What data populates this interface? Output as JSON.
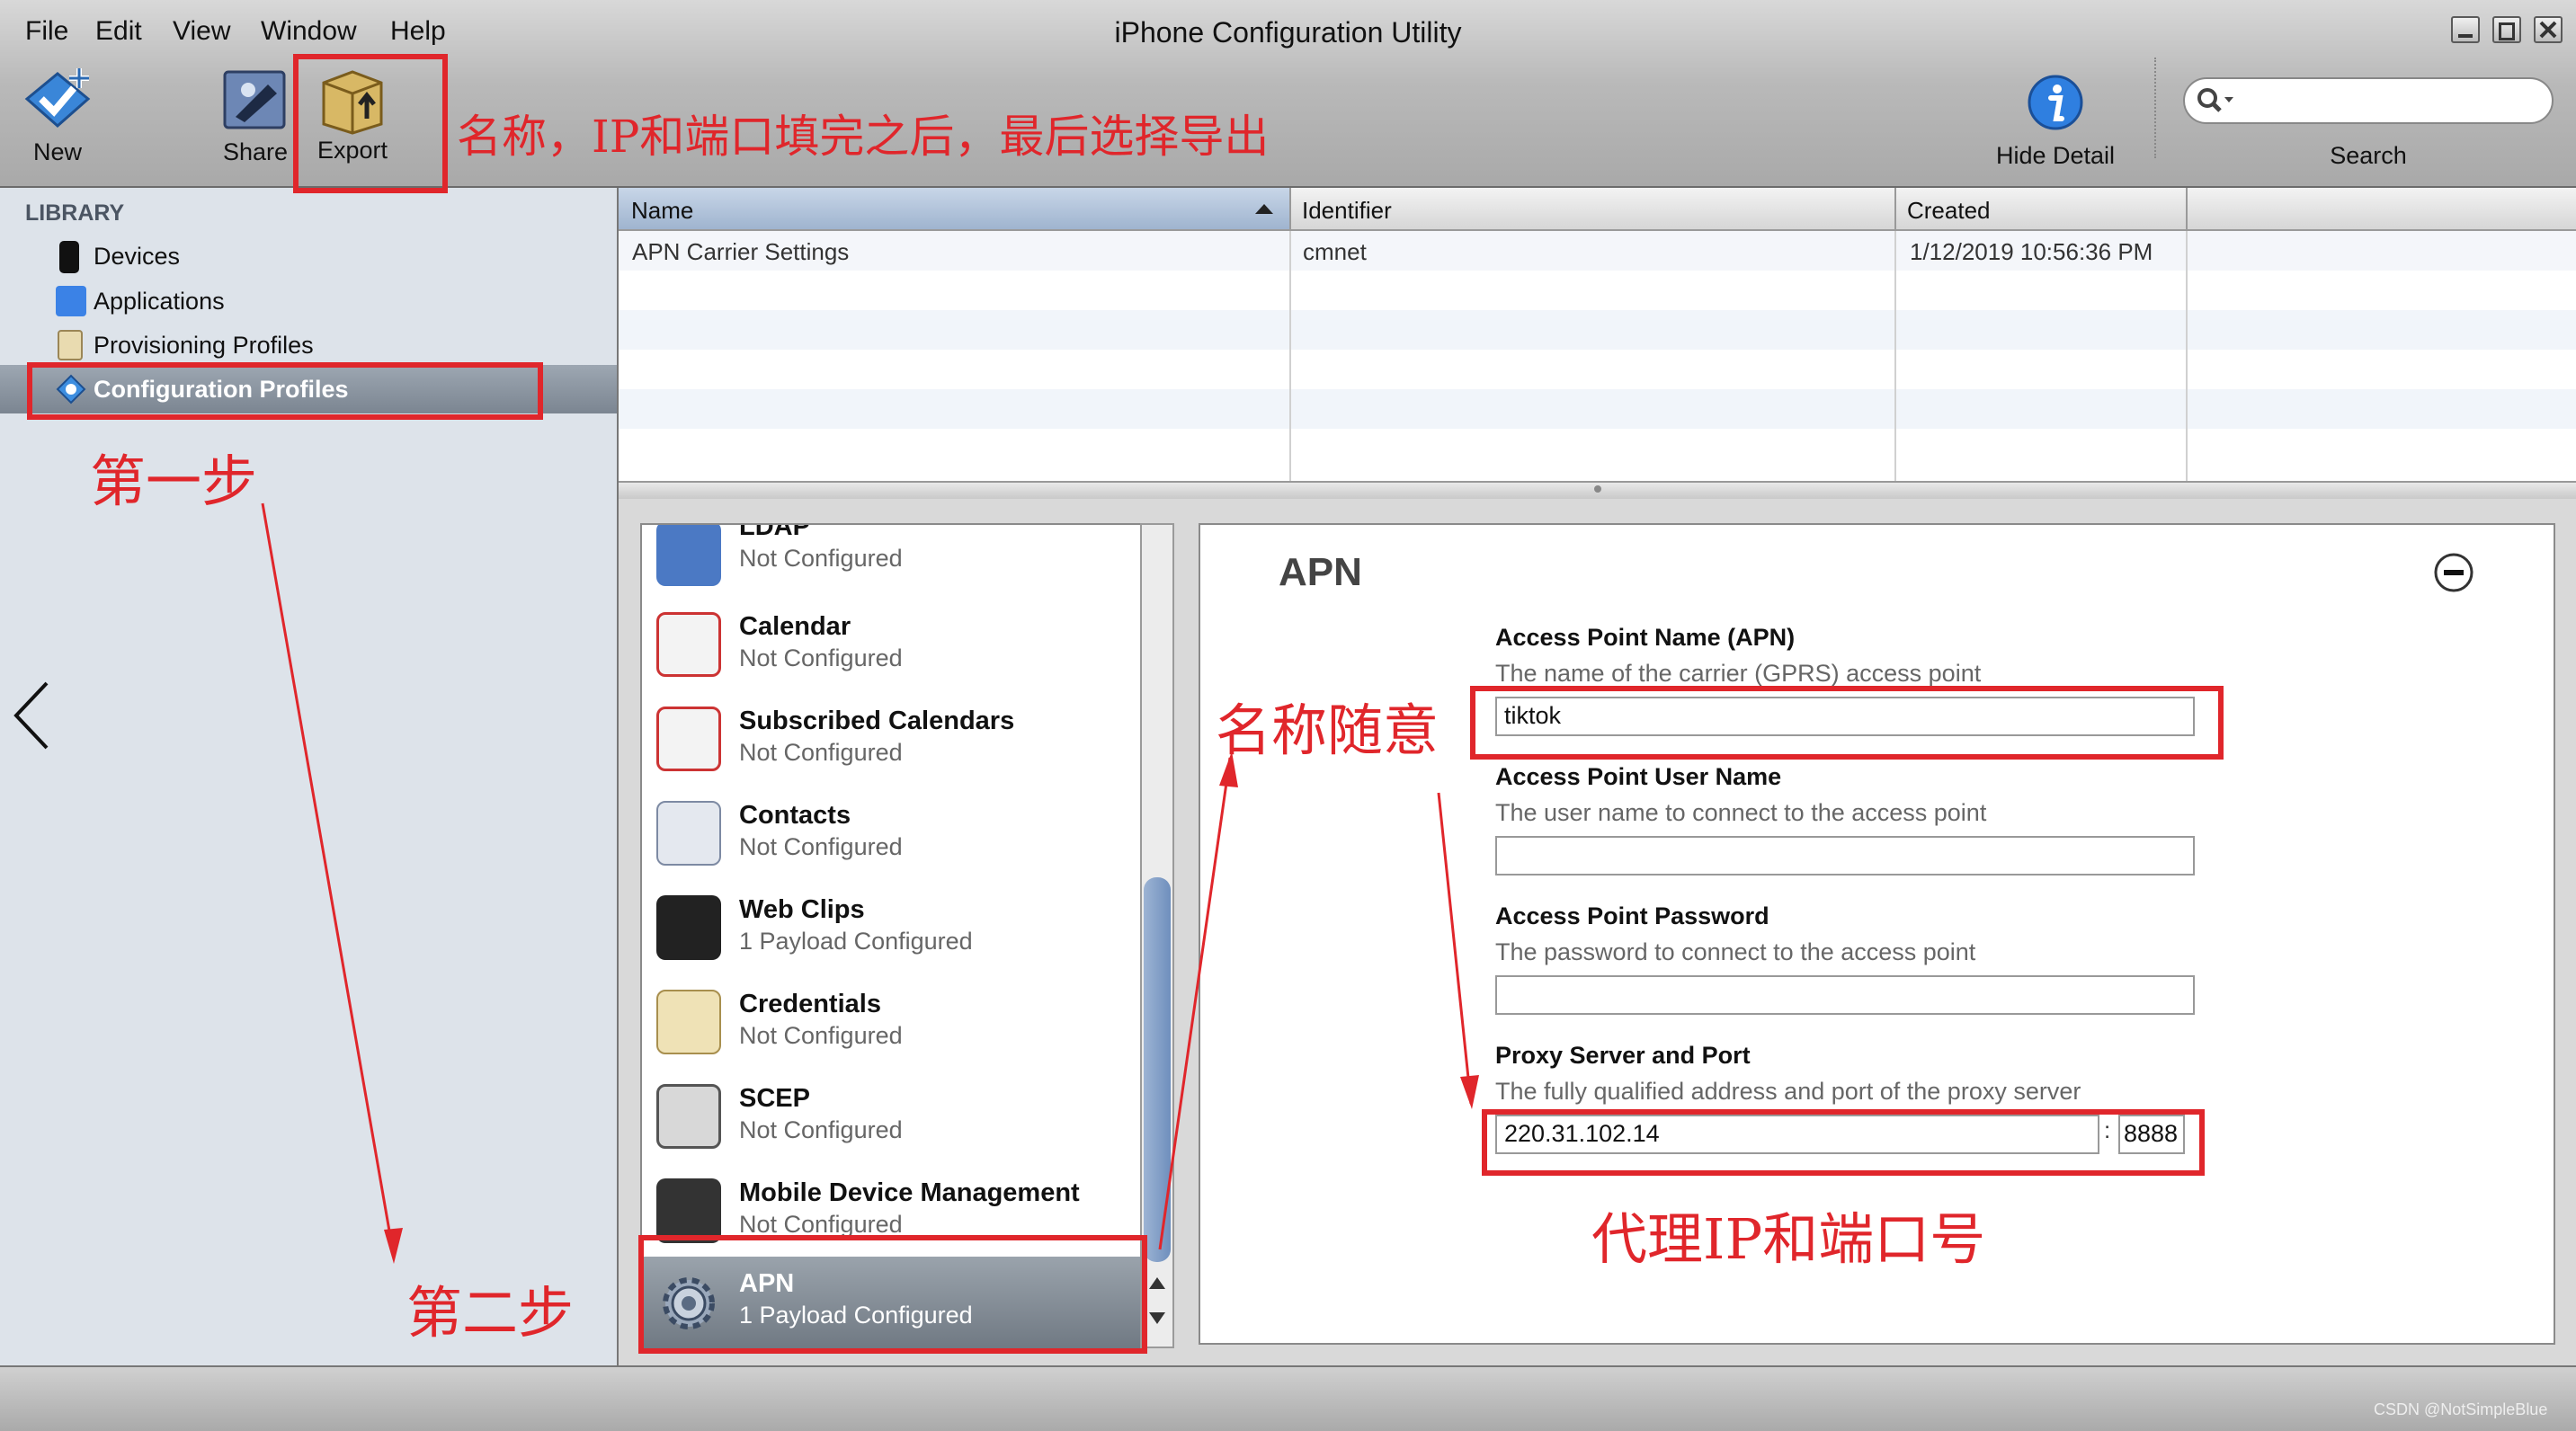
{
  "menu": [
    "File",
    "Edit",
    "View",
    "Window",
    "Help"
  ],
  "window_title": "iPhone Configuration Utility",
  "toolbar": {
    "new_label": "New",
    "share_label": "Share",
    "export_label": "Export",
    "hide_detail_label": "Hide Detail",
    "search_label": "Search",
    "search_value": ""
  },
  "sidebar": {
    "heading": "LIBRARY",
    "items": [
      {
        "label": "Devices",
        "icon": "iphone-icon"
      },
      {
        "label": "Applications",
        "icon": "app-store-icon"
      },
      {
        "label": "Provisioning Profiles",
        "icon": "certificate-icon"
      },
      {
        "label": "Configuration Profiles",
        "icon": "profile-gear-icon",
        "selected": true
      }
    ]
  },
  "table": {
    "columns": [
      "Name",
      "Identifier",
      "Created"
    ],
    "sort": "Name ascending",
    "rows": [
      {
        "name": "APN Carrier Settings",
        "identifier": "cmnet",
        "created": "1/12/2019 10:56:36 PM"
      }
    ]
  },
  "payloads": [
    {
      "title": "LDAP",
      "status": "Not Configured",
      "icon": "ldap-icon"
    },
    {
      "title": "Calendar",
      "status": "Not Configured",
      "icon": "calendar-icon"
    },
    {
      "title": "Subscribed Calendars",
      "status": "Not Configured",
      "icon": "subscribed-calendar-icon"
    },
    {
      "title": "Contacts",
      "status": "Not Configured",
      "icon": "contacts-icon"
    },
    {
      "title": "Web Clips",
      "status": "1 Payload Configured",
      "icon": "web-clip-icon"
    },
    {
      "title": "Credentials",
      "status": "Not Configured",
      "icon": "credentials-icon"
    },
    {
      "title": "SCEP",
      "status": "Not Configured",
      "icon": "scep-lock-icon"
    },
    {
      "title": "Mobile Device Management",
      "status": "Not Configured",
      "icon": "mdm-icon"
    },
    {
      "title": "APN",
      "status": "1 Payload Configured",
      "icon": "gear-icon",
      "selected": true
    }
  ],
  "apn": {
    "heading": "APN",
    "apn_name": {
      "label": "Access Point Name (APN)",
      "desc": "The name of the carrier (GPRS) access point",
      "value": "tiktok"
    },
    "user": {
      "label": "Access Point User Name",
      "desc": "The user name to connect to the access point",
      "value": ""
    },
    "password": {
      "label": "Access Point Password",
      "desc": "The password to connect to the access point",
      "value": ""
    },
    "proxy": {
      "label": "Proxy Server and Port",
      "desc": "The fully qualified address and port of the proxy server",
      "server": "220.31.102.14",
      "sep": ":",
      "port": "8888"
    }
  },
  "annotations": {
    "export_note": "名称，IP和端口填完之后，最后选择导出",
    "step1": "第一步",
    "step2": "第二步",
    "name_note": "名称随意",
    "proxy_note": "代理IP和端口号"
  },
  "watermark": "CSDN @NotSimpleBlue",
  "colors": {
    "annotation_red": "#e0262b",
    "selection": "#8a939e"
  }
}
